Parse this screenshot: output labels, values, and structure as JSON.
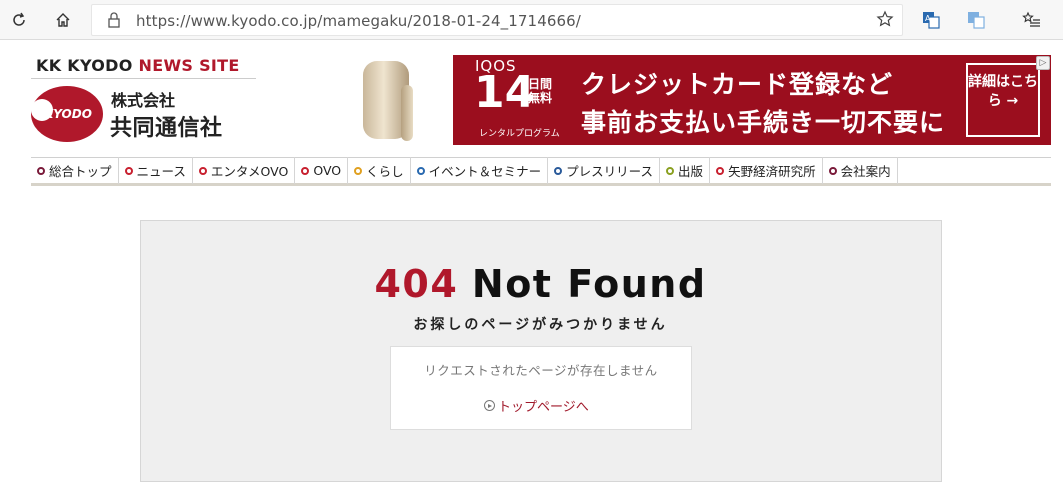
{
  "browser": {
    "url": "https://www.kyodo.co.jp/mamegaku/2018-01-24_1714666/",
    "icons": [
      "refresh-icon",
      "home-icon",
      "lock-icon",
      "star-icon",
      "translate-icon",
      "image-translate-icon",
      "favorites-list-icon"
    ]
  },
  "header": {
    "brand_prefix": "KK KYODO ",
    "brand_suffix": "NEWS SITE",
    "logo_text": "KYODO",
    "company_small": "株式会社",
    "company_large": "共同通信社"
  },
  "ad": {
    "brand": "IQOS",
    "days": "14",
    "days_suffix": "日間無料",
    "rental": "レンタルプログラム",
    "line1": "クレジットカード登録など",
    "line2": "事前お支払い手続き一切不要に",
    "cta": "詳細はこちら →"
  },
  "nav": {
    "items": [
      {
        "label": "総合トップ",
        "color": "#7a1a3a"
      },
      {
        "label": "ニュース",
        "color": "#c8202f"
      },
      {
        "label": "エンタメOVO",
        "color": "#c8202f"
      },
      {
        "label": "OVO",
        "color": "#c8202f"
      },
      {
        "label": "くらし",
        "color": "#e0a020"
      },
      {
        "label": "イベント＆セミナー",
        "color": "#2a6ab0"
      },
      {
        "label": "プレスリリース",
        "color": "#2a5a9a"
      },
      {
        "label": "出版",
        "color": "#8aa020"
      },
      {
        "label": "矢野経済研究所",
        "color": "#c8202f"
      },
      {
        "label": "会社案内",
        "color": "#7a1a3a"
      }
    ]
  },
  "error": {
    "code": "404",
    "title": "Not Found",
    "subtitle": "お探しのページがみつかりません",
    "message": "リクエストされたページが存在しません",
    "link_label": "トップページへ"
  },
  "colors": {
    "brand_red": "#b0182b",
    "ad_red": "#9b0e1e"
  }
}
